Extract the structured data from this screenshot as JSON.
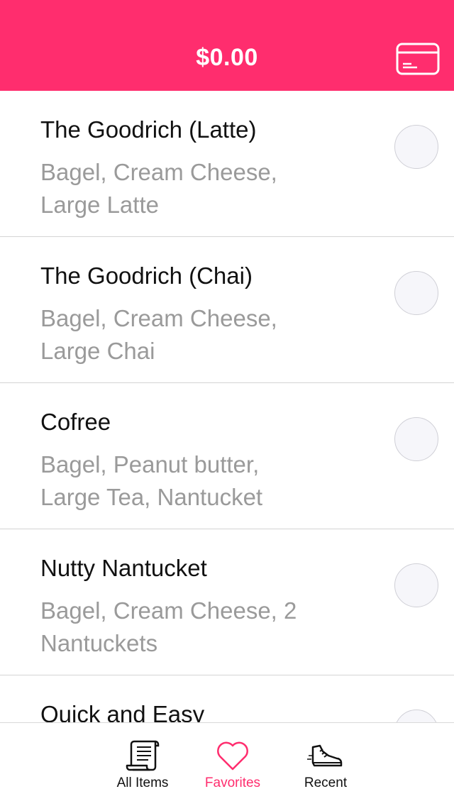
{
  "header": {
    "total": "$0.00",
    "card_icon": "credit-card-icon",
    "accent_color": "#ff2d6e"
  },
  "favorites": [
    {
      "title": "The Goodrich (Latte)",
      "description": "Bagel, Cream Cheese, Large Latte"
    },
    {
      "title": "The Goodrich (Chai)",
      "description": "Bagel, Cream Cheese, Large Chai"
    },
    {
      "title": "Cofree",
      "description": "Bagel, Peanut butter, Large Tea, Nantucket"
    },
    {
      "title": "Nutty Nantucket",
      "description": "Bagel, Cream Cheese, 2 Nantuckets"
    },
    {
      "title": "Quick and Easy",
      "description": ""
    }
  ],
  "tabbar": {
    "tabs": [
      {
        "label": "All Items",
        "icon": "scroll-icon",
        "active": false
      },
      {
        "label": "Favorites",
        "icon": "heart-icon",
        "active": true
      },
      {
        "label": "Recent",
        "icon": "sneaker-icon",
        "active": false
      }
    ]
  }
}
